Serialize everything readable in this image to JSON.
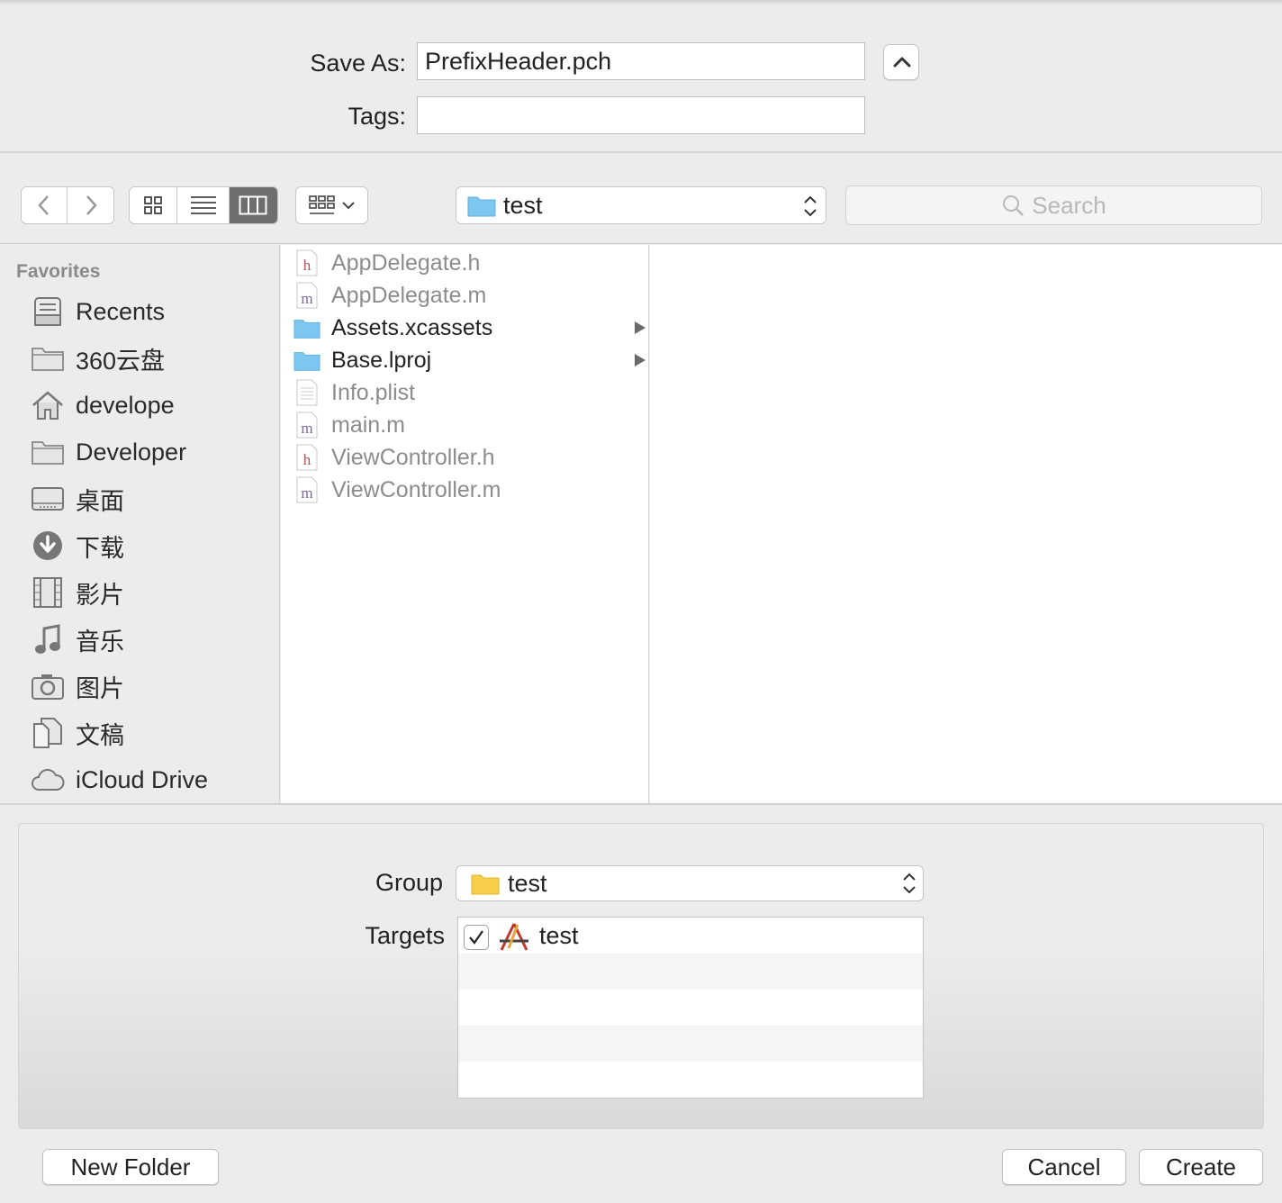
{
  "save_as": {
    "label": "Save As:",
    "value": "PrefixHeader.pch",
    "tags_label": "Tags:",
    "tags_value": ""
  },
  "toolbar": {
    "location": "test",
    "search_placeholder": "Search"
  },
  "sidebar": {
    "heading": "Favorites",
    "items": [
      {
        "label": "Recents",
        "icon": "recents-icon"
      },
      {
        "label": "360云盘",
        "icon": "folder-icon"
      },
      {
        "label": "develope",
        "icon": "home-icon"
      },
      {
        "label": "Developer",
        "icon": "folder-icon"
      },
      {
        "label": "桌面",
        "icon": "desktop-icon"
      },
      {
        "label": "下载",
        "icon": "downloads-icon"
      },
      {
        "label": "影片",
        "icon": "movies-icon"
      },
      {
        "label": "音乐",
        "icon": "music-icon"
      },
      {
        "label": "图片",
        "icon": "pictures-icon"
      },
      {
        "label": "文稿",
        "icon": "documents-icon"
      },
      {
        "label": "iCloud Drive",
        "icon": "cloud-icon"
      }
    ]
  },
  "files": [
    {
      "name": "AppDelegate.h",
      "type": "h"
    },
    {
      "name": "AppDelegate.m",
      "type": "m"
    },
    {
      "name": "Assets.xcassets",
      "type": "folder"
    },
    {
      "name": "Base.lproj",
      "type": "folder"
    },
    {
      "name": "Info.plist",
      "type": "plist"
    },
    {
      "name": "main.m",
      "type": "m"
    },
    {
      "name": "ViewController.h",
      "type": "h"
    },
    {
      "name": "ViewController.m",
      "type": "m"
    }
  ],
  "accessory": {
    "group_label": "Group",
    "group_value": "test",
    "targets_label": "Targets",
    "target_name": "test",
    "target_checked": true
  },
  "buttons": {
    "new_folder": "New Folder",
    "cancel": "Cancel",
    "create": "Create"
  },
  "colors": {
    "folder_blue": "#7cc6f0",
    "folder_yellow": "#f7cf4a",
    "header_file_red": "#b5525c",
    "impl_file_purple": "#7b6b9e"
  }
}
